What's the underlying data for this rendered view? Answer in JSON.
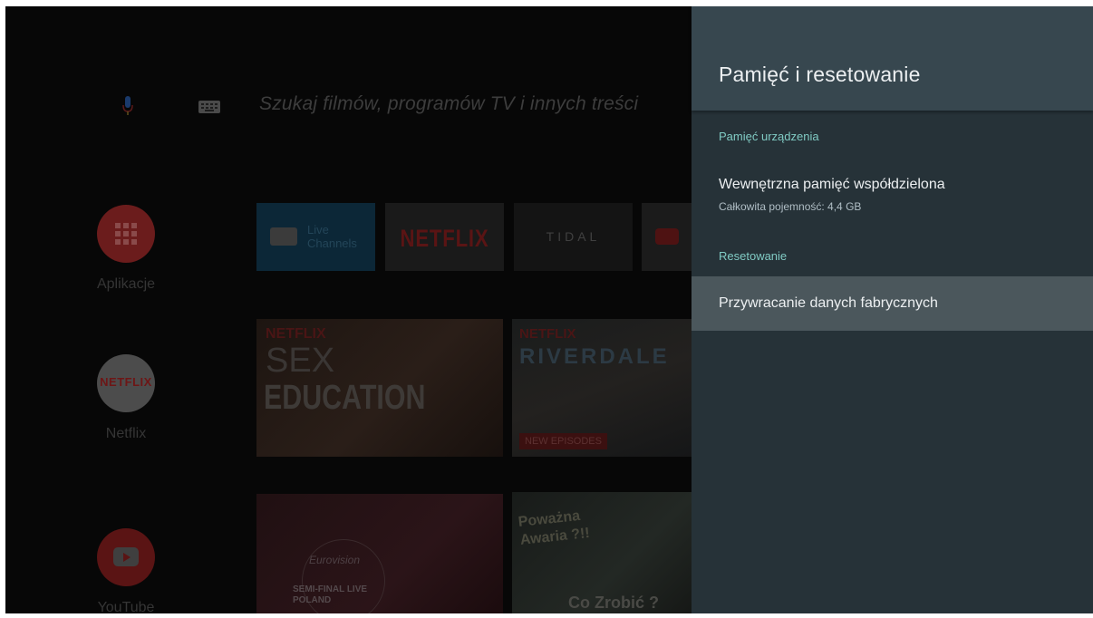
{
  "home": {
    "search_placeholder": "Szukaj filmów, programów TV i innych treści",
    "side_apps": [
      {
        "label": "Aplikacje"
      },
      {
        "label": "Netflix",
        "logo_text": "NETFLIX"
      },
      {
        "label": "YouTube"
      }
    ],
    "channel_tiles": [
      {
        "label": "Live Channels"
      },
      {
        "label": "NETFLIX"
      },
      {
        "label": "TIDAL"
      }
    ],
    "posters": [
      {
        "brand": "NETFLIX",
        "title_top": "SEX",
        "title_bottom": "EDUCATION"
      },
      {
        "brand": "NETFLIX",
        "title": "RIVERDALE",
        "badge": "NEW EPISODES"
      },
      {
        "title": "Eurovision",
        "subtitle": "SEMI-FINAL LIVE POLAND"
      },
      {
        "title_top": "Poważna Awaria ?!!",
        "title_bottom": "Co Zrobić ?"
      }
    ]
  },
  "panel": {
    "title": "Pamięć i resetowanie",
    "sections": [
      {
        "header": "Pamięć urządzenia",
        "items": [
          {
            "title": "Wewnętrzna pamięć współdzielona",
            "subtitle": "Całkowita pojemność: 4,4 GB"
          }
        ]
      },
      {
        "header": "Resetowanie",
        "items": [
          {
            "title": "Przywracanie danych fabrycznych",
            "focused": true
          }
        ]
      }
    ]
  },
  "colors": {
    "panel_bg": "#263238",
    "panel_header_bg": "#37474f",
    "section_header": "#80cbc4",
    "focused_item_bg": "#4b575c"
  },
  "icons": {
    "search_voice": "mic-icon",
    "search_keyboard": "keyboard-icon",
    "apps": "apps-grid-icon",
    "youtube": "youtube-play-icon",
    "tv": "tv-icon"
  }
}
